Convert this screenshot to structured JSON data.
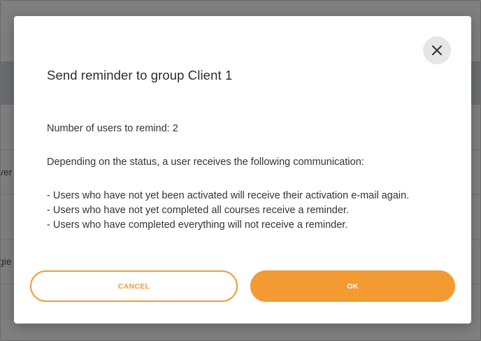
{
  "background": {
    "row_text_1": "ver",
    "row_text_2": "gie"
  },
  "dialog": {
    "title": "Send reminder to group Client 1",
    "users_count_line": "Number of users to remind: 2",
    "intro_line": "Depending on the status, a user receives the following communication:",
    "bullets": [
      "- Users who have not yet been activated will receive their activation e-mail again.",
      "- Users who have not yet completed all courses receive a reminder.",
      "- Users who have completed everything will not receive a reminder."
    ],
    "cancel_label": "CANCEL",
    "ok_label": "OK",
    "close_icon": "close-icon"
  },
  "colors": {
    "accent": "#f39a33",
    "overlay": "#7f7f7f",
    "close_bg": "#e6e6e6"
  }
}
